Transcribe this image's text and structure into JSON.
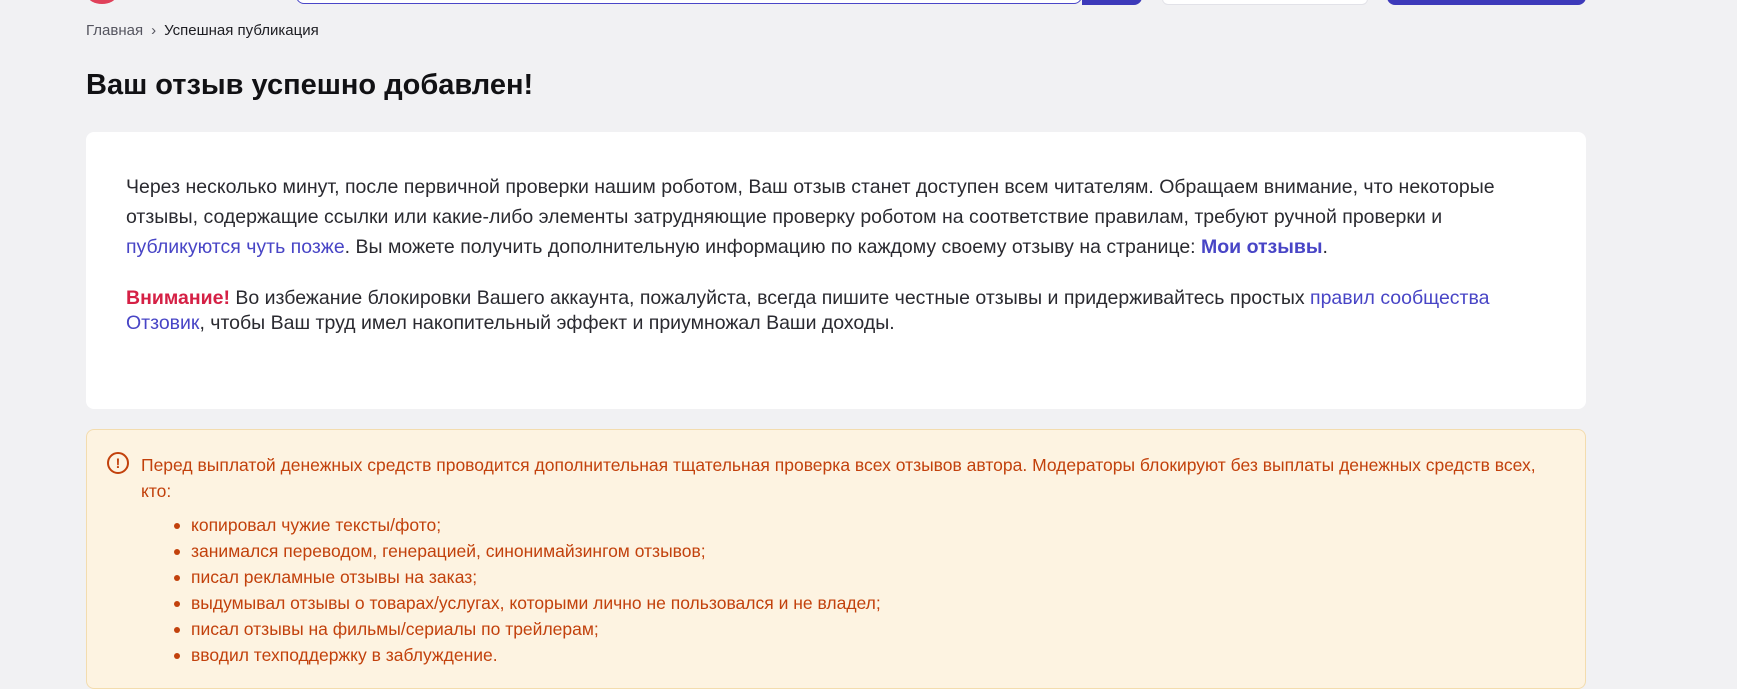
{
  "breadcrumb": {
    "home": "Главная",
    "separator": "›",
    "current": "Успешная публикация"
  },
  "page": {
    "title": "Ваш отзыв успешно добавлен!"
  },
  "card": {
    "text_part1": "Через несколько минут, после первичной проверки нашим роботом, Ваш отзыв станет доступен всем читателям. Обращаем внимание, что некоторые отзывы, содержащие ссылки или какие-либо элементы затрудняющие проверку роботом на соответствие правилам, требуют ручной проверки и ",
    "later_link": "публикуются чуть позже",
    "text_part2": ". Вы можете получить дополнительную информацию по каждому своему отзыву на странице: ",
    "my_reviews_link": "Мои отзывы",
    "text_part3": ".",
    "attention_label": "Внимание!",
    "notice_part1": " Во избежание блокировки Вашего аккаунта, пожалуйста, всегда пишите честные отзывы и придерживайтесь простых ",
    "rules_link": "правил сообщества Отзовик",
    "notice_part2": ", чтобы Ваш труд имел накопительный эффект и приумножал Ваши доходы."
  },
  "warning": {
    "icon": "exclamation-circle-icon",
    "text": "Перед выплатой денежных средств проводится дополнительная тщательная проверка всех отзывов автора. Модераторы блокируют без выплаты денежных средств всех, кто:",
    "items": [
      "копировал чужие тексты/фото;",
      "занимался переводом, генерацией, синонимайзингом отзывов;",
      "писал рекламные отзывы на заказ;",
      "выдумывал отзывы о товарах/услугах, которыми лично не пользовался и не владел;",
      "писал отзывы на фильмы/сериалы по трейлерам;",
      "вводил техподдержку в заблуждение."
    ]
  },
  "colors": {
    "background": "#f1f1f3",
    "link": "#4845c6",
    "brand_button": "#3d3aba",
    "attention": "#d52045",
    "warning_text": "#c2410c",
    "warning_bg": "#fdf3e1"
  }
}
